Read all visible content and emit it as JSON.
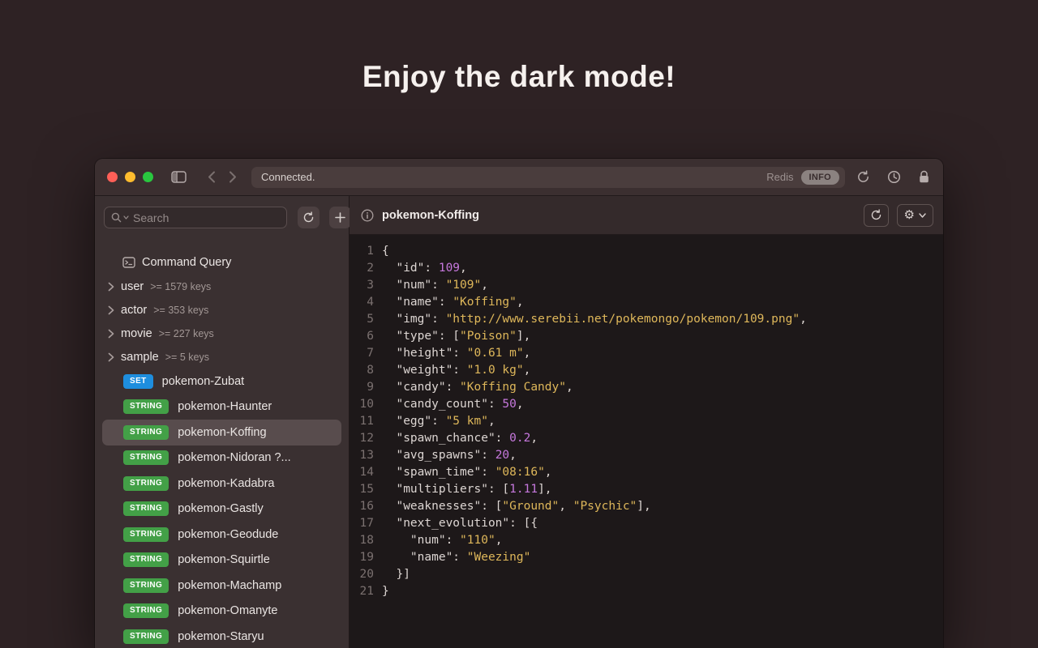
{
  "hero": {
    "title": "Enjoy the dark mode!"
  },
  "titlebar": {
    "status": "Connected.",
    "redis_label": "Redis",
    "info_badge": "INFO"
  },
  "sidebar": {
    "search_placeholder": "Search",
    "command_query_label": "Command Query",
    "groups": [
      {
        "name": "user",
        "count": ">= 1579 keys"
      },
      {
        "name": "actor",
        "count": ">= 353 keys"
      },
      {
        "name": "movie",
        "count": ">= 227 keys"
      },
      {
        "name": "sample",
        "count": ">= 5 keys"
      }
    ],
    "badge_colors": {
      "SET": "#1e8ede",
      "STRING": "#43a047"
    },
    "keys": [
      {
        "type": "SET",
        "label": "pokemon-Zubat",
        "selected": false
      },
      {
        "type": "STRING",
        "label": "pokemon-Haunter",
        "selected": false
      },
      {
        "type": "STRING",
        "label": "pokemon-Koffing",
        "selected": true
      },
      {
        "type": "STRING",
        "label": "pokemon-Nidoran ?...",
        "selected": false
      },
      {
        "type": "STRING",
        "label": "pokemon-Kadabra",
        "selected": false
      },
      {
        "type": "STRING",
        "label": "pokemon-Gastly",
        "selected": false
      },
      {
        "type": "STRING",
        "label": "pokemon-Geodude",
        "selected": false
      },
      {
        "type": "STRING",
        "label": "pokemon-Squirtle",
        "selected": false
      },
      {
        "type": "STRING",
        "label": "pokemon-Machamp",
        "selected": false
      },
      {
        "type": "STRING",
        "label": "pokemon-Omanyte",
        "selected": false
      },
      {
        "type": "STRING",
        "label": "pokemon-Staryu",
        "selected": false
      }
    ]
  },
  "main": {
    "title": "pokemon-Koffing"
  },
  "editor": {
    "token_colors": {
      "plain": "#ddd6d3",
      "string": "#deb75a",
      "number": "#c678dd"
    },
    "lines": [
      [
        [
          "p",
          "{"
        ]
      ],
      [
        [
          "p",
          "  \"id\": "
        ],
        [
          "n",
          "109"
        ],
        [
          "p",
          ","
        ]
      ],
      [
        [
          "p",
          "  \"num\": "
        ],
        [
          "s",
          "\"109\""
        ],
        [
          "p",
          ","
        ]
      ],
      [
        [
          "p",
          "  \"name\": "
        ],
        [
          "s",
          "\"Koffing\""
        ],
        [
          "p",
          ","
        ]
      ],
      [
        [
          "p",
          "  \"img\": "
        ],
        [
          "s",
          "\"http://www.serebii.net/pokemongo/pokemon/109.png\""
        ],
        [
          "p",
          ","
        ]
      ],
      [
        [
          "p",
          "  \"type\": ["
        ],
        [
          "s",
          "\"Poison\""
        ],
        [
          "p",
          "],"
        ]
      ],
      [
        [
          "p",
          "  \"height\": "
        ],
        [
          "s",
          "\"0.61 m\""
        ],
        [
          "p",
          ","
        ]
      ],
      [
        [
          "p",
          "  \"weight\": "
        ],
        [
          "s",
          "\"1.0 kg\""
        ],
        [
          "p",
          ","
        ]
      ],
      [
        [
          "p",
          "  \"candy\": "
        ],
        [
          "s",
          "\"Koffing Candy\""
        ],
        [
          "p",
          ","
        ]
      ],
      [
        [
          "p",
          "  \"candy_count\": "
        ],
        [
          "n",
          "50"
        ],
        [
          "p",
          ","
        ]
      ],
      [
        [
          "p",
          "  \"egg\": "
        ],
        [
          "s",
          "\"5 km\""
        ],
        [
          "p",
          ","
        ]
      ],
      [
        [
          "p",
          "  \"spawn_chance\": "
        ],
        [
          "n",
          "0.2"
        ],
        [
          "p",
          ","
        ]
      ],
      [
        [
          "p",
          "  \"avg_spawns\": "
        ],
        [
          "n",
          "20"
        ],
        [
          "p",
          ","
        ]
      ],
      [
        [
          "p",
          "  \"spawn_time\": "
        ],
        [
          "s",
          "\"08:16\""
        ],
        [
          "p",
          ","
        ]
      ],
      [
        [
          "p",
          "  \"multipliers\": ["
        ],
        [
          "n",
          "1.11"
        ],
        [
          "p",
          "],"
        ]
      ],
      [
        [
          "p",
          "  \"weaknesses\": ["
        ],
        [
          "s",
          "\"Ground\""
        ],
        [
          "p",
          ", "
        ],
        [
          "s",
          "\"Psychic\""
        ],
        [
          "p",
          "],"
        ]
      ],
      [
        [
          "p",
          "  \"next_evolution\": [{"
        ]
      ],
      [
        [
          "p",
          "    \"num\": "
        ],
        [
          "s",
          "\"110\""
        ],
        [
          "p",
          ","
        ]
      ],
      [
        [
          "p",
          "    \"name\": "
        ],
        [
          "s",
          "\"Weezing\""
        ]
      ],
      [
        [
          "p",
          "  }]"
        ]
      ],
      [
        [
          "p",
          "}"
        ]
      ]
    ]
  }
}
